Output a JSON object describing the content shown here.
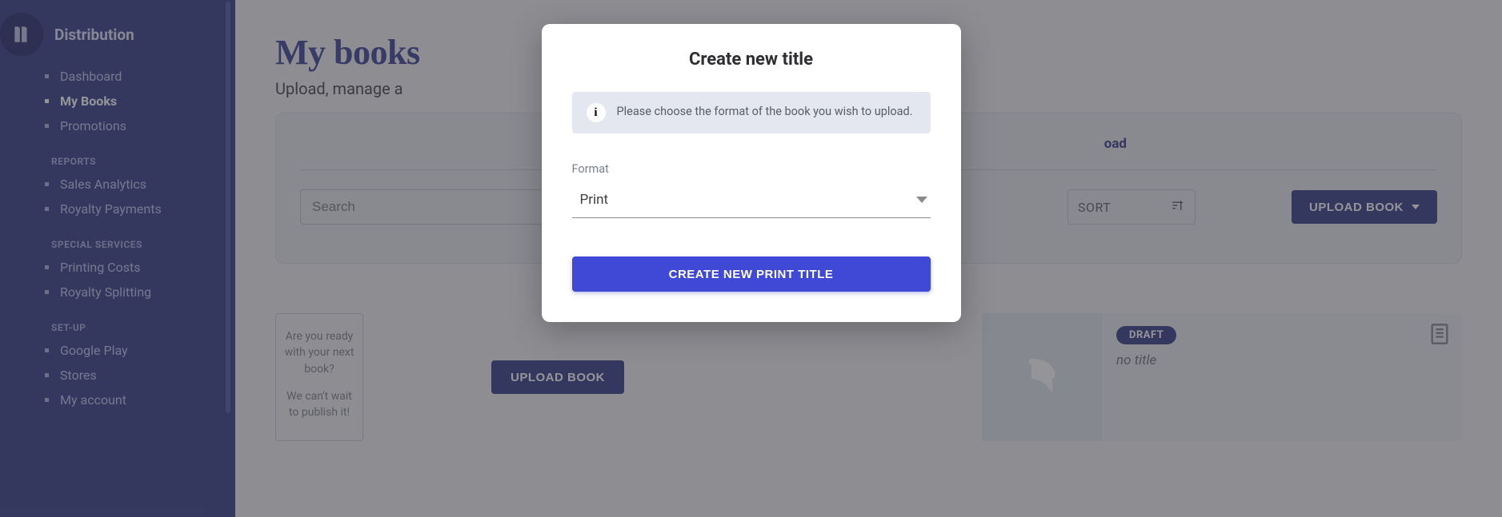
{
  "sidebar": {
    "section_title": "Distribution",
    "items": [
      {
        "label": "Dashboard"
      },
      {
        "label": "My Books"
      },
      {
        "label": "Promotions"
      }
    ],
    "sections": {
      "reports": {
        "label": "REPORTS",
        "items": [
          {
            "label": "Sales Analytics"
          },
          {
            "label": "Royalty Payments"
          }
        ]
      },
      "special": {
        "label": "SPECIAL SERVICES",
        "items": [
          {
            "label": "Printing Costs"
          },
          {
            "label": "Royalty Splitting"
          }
        ]
      },
      "setup": {
        "label": "SET-UP",
        "items": [
          {
            "label": "Google Play"
          },
          {
            "label": "Stores"
          },
          {
            "label": "My account"
          }
        ]
      }
    }
  },
  "main": {
    "title": "My books",
    "subtitle_visible": "Upload, manage a",
    "pending_suffix": "oad",
    "search_placeholder": "Search",
    "sort_label": "SORT",
    "upload_top": "UPLOAD BOOK",
    "ready_line1": "Are you ready with your next book?",
    "ready_line2": "We can't wait to publish it!",
    "upload_mid": "UPLOAD BOOK",
    "draft_badge": "DRAFT",
    "draft_title": "no title"
  },
  "modal": {
    "title": "Create new title",
    "info_text": "Please choose the format of the book you wish to upload.",
    "info_glyph": "i",
    "format_label": "Format",
    "format_value": "Print",
    "create_label": "CREATE NEW PRINT TITLE"
  }
}
